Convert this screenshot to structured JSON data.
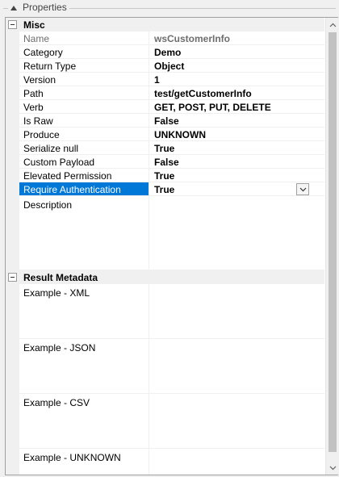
{
  "panel": {
    "title": "Properties"
  },
  "categories": [
    {
      "label": "Misc"
    },
    {
      "label": "Result Metadata"
    }
  ],
  "misc_properties": [
    {
      "name": "Name",
      "value": "wsCustomerInfo"
    },
    {
      "name": "Category",
      "value": "Demo"
    },
    {
      "name": "Return Type",
      "value": "Object"
    },
    {
      "name": "Version",
      "value": "1"
    },
    {
      "name": "Path",
      "value": "test/getCustomerInfo"
    },
    {
      "name": "Verb",
      "value": "GET, POST, PUT, DELETE"
    },
    {
      "name": "Is Raw",
      "value": "False"
    },
    {
      "name": "Produce",
      "value": "UNKNOWN"
    },
    {
      "name": "Serialize null",
      "value": "True"
    },
    {
      "name": "Custom Payload",
      "value": "False"
    },
    {
      "name": "Elevated Permission",
      "value": "True"
    },
    {
      "name": "Require Authentication",
      "value": "True"
    },
    {
      "name": "Description",
      "value": ""
    }
  ],
  "result_metadata": [
    {
      "name": "Example - XML",
      "value": ""
    },
    {
      "name": "Example - JSON",
      "value": ""
    },
    {
      "name": "Example - CSV",
      "value": ""
    },
    {
      "name": "Example - UNKNOWN",
      "value": ""
    }
  ],
  "icons": {
    "collapse": "collapse-icon",
    "dropdown": "chevron-down-icon",
    "scroll_up": "scroll-up-icon",
    "scroll_down": "scroll-down-icon"
  },
  "colors": {
    "selection": "#0078d7",
    "disabled_text": "#6d6d6d"
  }
}
